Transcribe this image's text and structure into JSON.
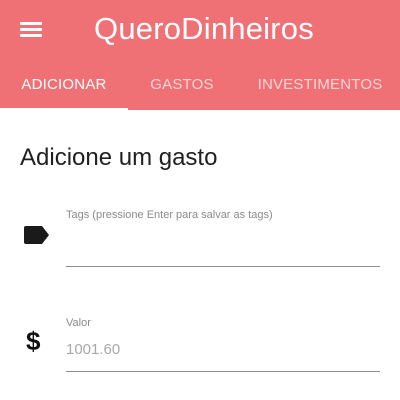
{
  "appbar": {
    "title": "QueroDinheiros",
    "menu_icon": "hamburger-menu-icon",
    "color": "#f07175"
  },
  "tabs": [
    {
      "label": "ADICIONAR",
      "active": true
    },
    {
      "label": "GASTOS",
      "active": false
    },
    {
      "label": "INVESTIMENTOS",
      "active": false
    }
  ],
  "form": {
    "heading": "Adicione um gasto",
    "tags": {
      "icon": "label-tag-icon",
      "label": "Tags (pressione Enter para salvar as tags)",
      "value": "",
      "placeholder": ""
    },
    "valor": {
      "icon": "dollar-icon",
      "icon_glyph": "$",
      "label": "Valor",
      "value": "",
      "placeholder": "1001.60"
    }
  }
}
